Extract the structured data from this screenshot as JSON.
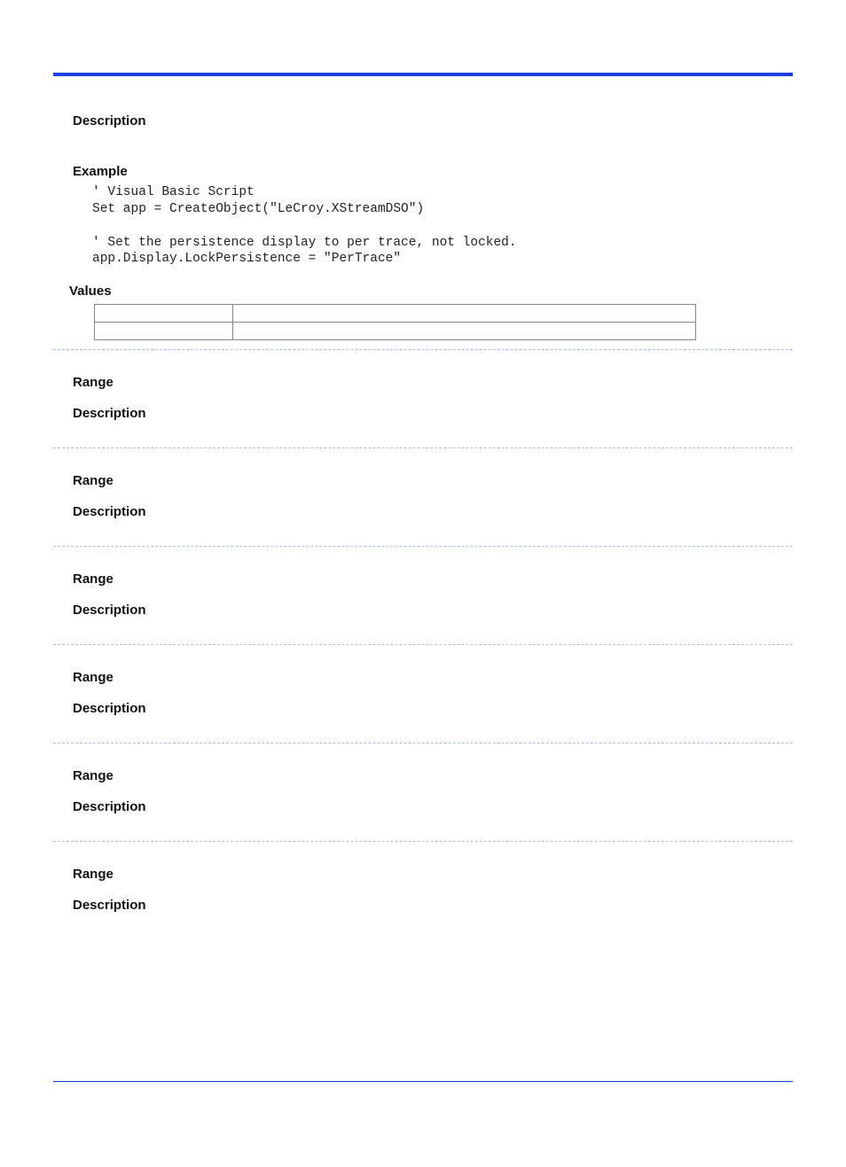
{
  "labels": {
    "description": "Description",
    "example": "Example",
    "values": "Values",
    "range": "Range"
  },
  "example_code": "' Visual Basic Script\nSet app = CreateObject(\"LeCroy.XStreamDSO\")\n\n' Set the persistence display to per trace, not locked.\napp.Display.LockPersistence = \"PerTrace\"",
  "values_table": {
    "rows": [
      {
        "col1": "",
        "col2": ""
      },
      {
        "col1": "",
        "col2": ""
      }
    ]
  },
  "blocks": [
    {
      "range": "",
      "description": ""
    },
    {
      "range": "",
      "description": ""
    },
    {
      "range": "",
      "description": ""
    },
    {
      "range": "",
      "description": ""
    },
    {
      "range": "",
      "description": ""
    },
    {
      "range": "",
      "description": ""
    }
  ]
}
